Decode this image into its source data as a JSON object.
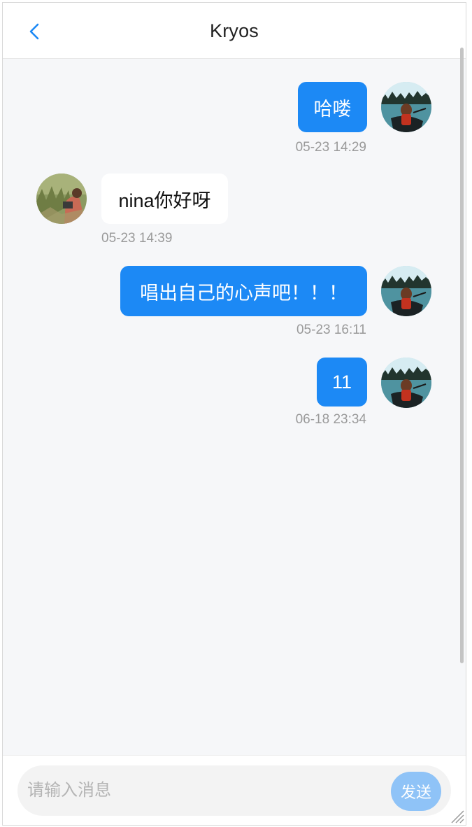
{
  "header": {
    "title": "Kryos",
    "back_icon": "chevron-left-icon"
  },
  "messages": [
    {
      "sender": "me",
      "text": "哈喽",
      "time": "05-23 14:29"
    },
    {
      "sender": "other",
      "text": "nina你好呀",
      "time": "05-23 14:39"
    },
    {
      "sender": "me",
      "text": "唱出自己的心声吧！！！",
      "time": "05-23 16:11"
    },
    {
      "sender": "me",
      "text": "11",
      "time": "06-18 23:34"
    }
  ],
  "composer": {
    "placeholder": "请输入消息",
    "value": "",
    "send_label": "发送"
  },
  "colors": {
    "accent": "#1c89f5",
    "send_button": "#8fc3f7",
    "chat_background": "#f6f7f9"
  }
}
